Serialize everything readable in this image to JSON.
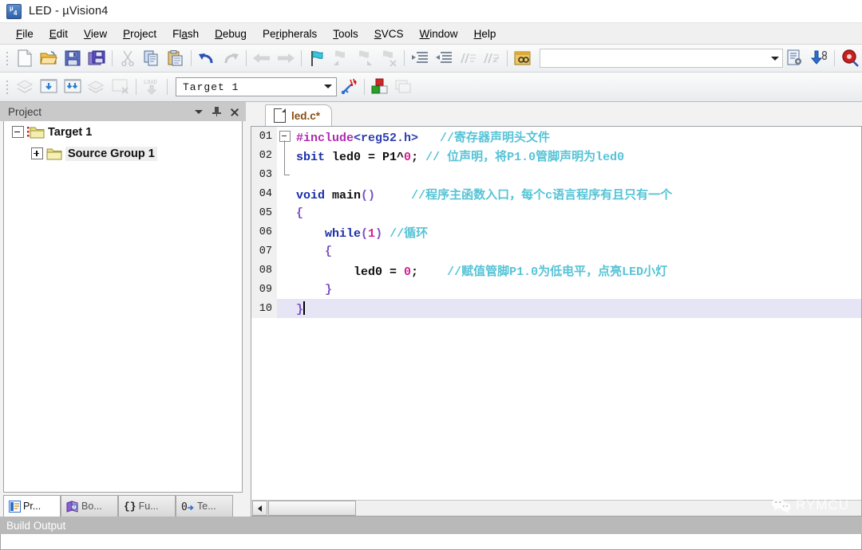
{
  "window": {
    "title": "LED  - µVision4",
    "icon": "uvision-app-icon"
  },
  "menubar": {
    "items": [
      {
        "label": "File",
        "accel": "F"
      },
      {
        "label": "Edit",
        "accel": "E"
      },
      {
        "label": "View",
        "accel": "V"
      },
      {
        "label": "Project",
        "accel": "P"
      },
      {
        "label": "Flash",
        "accel": "a"
      },
      {
        "label": "Debug",
        "accel": "D"
      },
      {
        "label": "Peripherals",
        "accel": "r"
      },
      {
        "label": "Tools",
        "accel": "T"
      },
      {
        "label": "SVCS",
        "accel": "S"
      },
      {
        "label": "Window",
        "accel": "W"
      },
      {
        "label": "Help",
        "accel": "H"
      }
    ]
  },
  "toolbar_main": {
    "buttons": [
      {
        "name": "new-file-icon",
        "tooltip": "New",
        "enabled": true
      },
      {
        "name": "open-folder-icon",
        "tooltip": "Open",
        "enabled": true
      },
      {
        "name": "save-icon",
        "tooltip": "Save",
        "enabled": true
      },
      {
        "name": "save-all-icon",
        "tooltip": "Save All",
        "enabled": true
      },
      {
        "name": "cut-icon",
        "tooltip": "Cut",
        "enabled": false
      },
      {
        "name": "copy-icon",
        "tooltip": "Copy",
        "enabled": true
      },
      {
        "name": "paste-icon",
        "tooltip": "Paste",
        "enabled": true
      },
      {
        "name": "undo-icon",
        "tooltip": "Undo",
        "enabled": true
      },
      {
        "name": "redo-icon",
        "tooltip": "Redo",
        "enabled": false
      },
      {
        "name": "navigate-back-icon",
        "tooltip": "Back",
        "enabled": false
      },
      {
        "name": "navigate-forward-icon",
        "tooltip": "Forward",
        "enabled": false
      },
      {
        "name": "bookmark-toggle-icon",
        "tooltip": "Insert/Remove Bookmark",
        "enabled": true
      },
      {
        "name": "bookmark-prev-icon",
        "tooltip": "Previous Bookmark",
        "enabled": false
      },
      {
        "name": "bookmark-next-icon",
        "tooltip": "Next Bookmark",
        "enabled": false
      },
      {
        "name": "bookmark-clear-icon",
        "tooltip": "Clear All Bookmarks",
        "enabled": false
      },
      {
        "name": "indent-icon",
        "tooltip": "Indent Selection",
        "enabled": true
      },
      {
        "name": "outdent-icon",
        "tooltip": "Outdent Selection",
        "enabled": true
      },
      {
        "name": "comment-icon",
        "tooltip": "Comment Selection",
        "enabled": false
      },
      {
        "name": "uncomment-icon",
        "tooltip": "Uncomment Selection",
        "enabled": false
      },
      {
        "name": "find-in-files-icon",
        "tooltip": "Find in Files",
        "enabled": true
      }
    ],
    "search": {
      "value": "",
      "placeholder": ""
    },
    "right_buttons": [
      {
        "name": "configure-toolbars-icon",
        "tooltip": "Configuration Wizard",
        "enabled": true
      },
      {
        "name": "download-icon",
        "tooltip": "Download",
        "enabled": true
      },
      {
        "name": "start-debug-icon",
        "tooltip": "Start/Stop Debug Session",
        "enabled": true
      }
    ]
  },
  "toolbar_build": {
    "buttons": [
      {
        "name": "translate-icon",
        "tooltip": "Translate",
        "enabled": false
      },
      {
        "name": "build-icon",
        "tooltip": "Build",
        "enabled": true
      },
      {
        "name": "rebuild-icon",
        "tooltip": "Rebuild",
        "enabled": true
      },
      {
        "name": "batch-build-icon",
        "tooltip": "Batch Build",
        "enabled": false
      },
      {
        "name": "stop-build-icon",
        "tooltip": "Stop Build",
        "enabled": false
      },
      {
        "name": "download-load-icon",
        "tooltip": "Download to Flash",
        "label": "LOAD",
        "enabled": false
      }
    ],
    "target_combo": {
      "value": "Target 1",
      "options": [
        "Target 1"
      ]
    },
    "right_buttons": [
      {
        "name": "target-options-icon",
        "tooltip": "Options for Target",
        "enabled": true
      },
      {
        "name": "manage-project-items-icon",
        "tooltip": "Manage Project Items",
        "enabled": true
      },
      {
        "name": "manage-components-icon",
        "tooltip": "Manage Components",
        "enabled": false
      }
    ]
  },
  "project_panel": {
    "title": "Project",
    "header_buttons": [
      {
        "name": "panel-menu-chevron-icon"
      },
      {
        "name": "pin-icon"
      },
      {
        "name": "close-icon"
      }
    ],
    "tree": [
      {
        "label": "Target 1",
        "expanded": true,
        "icon": "target-folder-icon",
        "selected": false
      },
      {
        "label": "Source Group 1",
        "expanded": false,
        "icon": "folder-icon",
        "selected": true
      }
    ],
    "tabs": [
      {
        "label": "Pr...",
        "full": "Project",
        "icon": "project-icon",
        "active": true
      },
      {
        "label": "Bo...",
        "full": "Books",
        "icon": "books-icon",
        "active": false
      },
      {
        "label": "Fu...",
        "full": "Functions",
        "icon": "braces-icon",
        "active": false
      },
      {
        "label": "Te...",
        "full": "Templates",
        "icon": "templates-icon",
        "active": false
      }
    ]
  },
  "editor": {
    "tabs": [
      {
        "label": "led.c*",
        "icon": "document-icon",
        "active": true,
        "modified": true
      }
    ],
    "current_line": 10,
    "lines": [
      {
        "num": "01",
        "fold": "start",
        "tokens": [
          {
            "t": "#include",
            "c": "pp"
          },
          {
            "t": "<reg52.h>",
            "c": "inc"
          },
          {
            "t": "   ",
            "c": "cn"
          },
          {
            "t": "//寄存器声明头文件",
            "c": "cm"
          }
        ]
      },
      {
        "num": "02",
        "fold": "mid",
        "tokens": [
          {
            "t": "sbit",
            "c": "kw"
          },
          {
            "t": " led0 = P1^",
            "c": "cn"
          },
          {
            "t": "0",
            "c": "num"
          },
          {
            "t": "; ",
            "c": "cn"
          },
          {
            "t": "// 位声明，将P1.0管脚声明为led0",
            "c": "cm"
          }
        ]
      },
      {
        "num": "03",
        "fold": "end",
        "tokens": []
      },
      {
        "num": "04",
        "fold": "none",
        "tokens": [
          {
            "t": "void",
            "c": "kw"
          },
          {
            "t": " main",
            "c": "cn"
          },
          {
            "t": "()",
            "c": "punc"
          },
          {
            "t": "     ",
            "c": "cn"
          },
          {
            "t": "//程序主函数入口，每个c语言程序有且只有一个",
            "c": "cm"
          }
        ]
      },
      {
        "num": "05",
        "fold": "none",
        "tokens": [
          {
            "t": "{",
            "c": "punc"
          }
        ]
      },
      {
        "num": "06",
        "fold": "none",
        "tokens": [
          {
            "t": "    ",
            "c": "cn"
          },
          {
            "t": "while",
            "c": "kw"
          },
          {
            "t": "(",
            "c": "punc"
          },
          {
            "t": "1",
            "c": "num"
          },
          {
            "t": ")",
            "c": "punc"
          },
          {
            "t": " ",
            "c": "cn"
          },
          {
            "t": "//循环",
            "c": "cm"
          }
        ]
      },
      {
        "num": "07",
        "fold": "none",
        "tokens": [
          {
            "t": "    ",
            "c": "cn"
          },
          {
            "t": "{",
            "c": "punc"
          }
        ]
      },
      {
        "num": "08",
        "fold": "none",
        "tokens": [
          {
            "t": "        led0 = ",
            "c": "cn"
          },
          {
            "t": "0",
            "c": "num"
          },
          {
            "t": ";",
            "c": "cn"
          },
          {
            "t": "    ",
            "c": "cn"
          },
          {
            "t": "//赋值管脚P1.0为低电平，点亮LED小灯",
            "c": "cm"
          }
        ]
      },
      {
        "num": "09",
        "fold": "none",
        "tokens": [
          {
            "t": "    ",
            "c": "cn"
          },
          {
            "t": "}",
            "c": "punc"
          }
        ]
      },
      {
        "num": "10",
        "fold": "none",
        "current": true,
        "tokens": [
          {
            "t": "}",
            "c": "punc"
          }
        ]
      }
    ],
    "hscroll": {
      "left_arrow": "scroll-left-icon"
    }
  },
  "build_output": {
    "title": "Build Output",
    "content": ""
  },
  "watermark": {
    "text": "RYMCU",
    "icon": "wechat-icon"
  },
  "colors": {
    "accent": "#2f5fa8",
    "comment": "#56c3d6",
    "keyword": "#1a2ea8",
    "preprocessor": "#b02ab0",
    "number": "#d02090",
    "tab_label": "#8a4d12",
    "current_line": "#e5e5f5"
  }
}
